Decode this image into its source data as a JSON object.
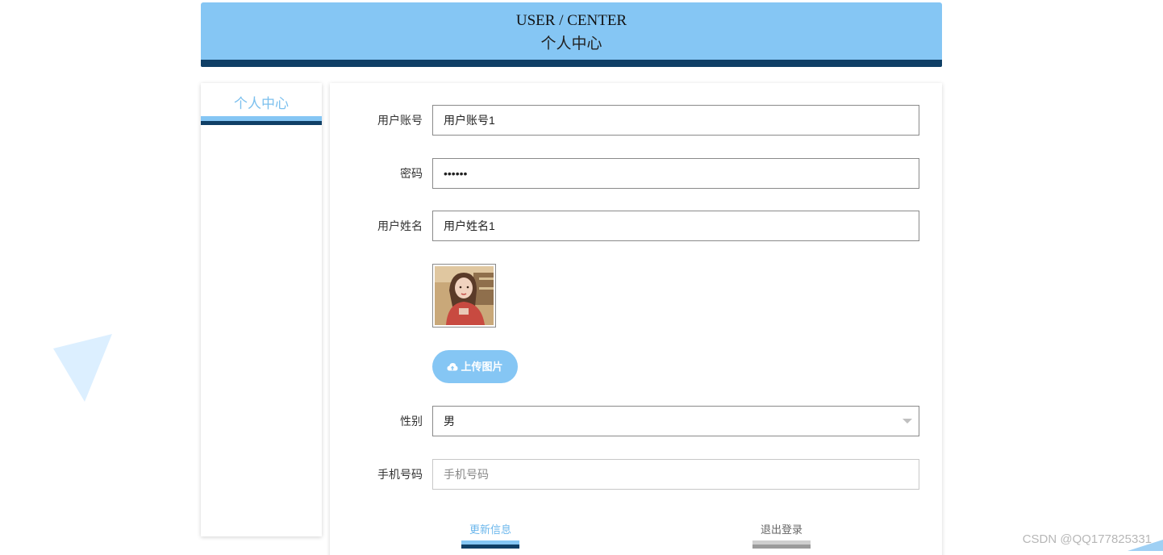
{
  "header": {
    "title_en": "USER / CENTER",
    "title_cn": "个人中心"
  },
  "sidebar": {
    "items": [
      {
        "label": "个人中心"
      }
    ]
  },
  "form": {
    "username": {
      "label": "用户账号",
      "value": "用户账号1"
    },
    "password": {
      "label": "密码",
      "value": "••••••"
    },
    "realname": {
      "label": "用户姓名",
      "value": "用户姓名1"
    },
    "avatar": {
      "description": "avatar-image"
    },
    "upload_label": "上传图片",
    "gender": {
      "label": "性别",
      "value": "男"
    },
    "phone": {
      "label": "手机号码",
      "placeholder": "手机号码",
      "value": ""
    }
  },
  "actions": {
    "update_label": "更新信息",
    "logout_label": "退出登录"
  },
  "watermark": "CSDN @QQ177825331",
  "colors": {
    "accent": "#85c6f4",
    "dark_accent": "#0f3f66"
  }
}
